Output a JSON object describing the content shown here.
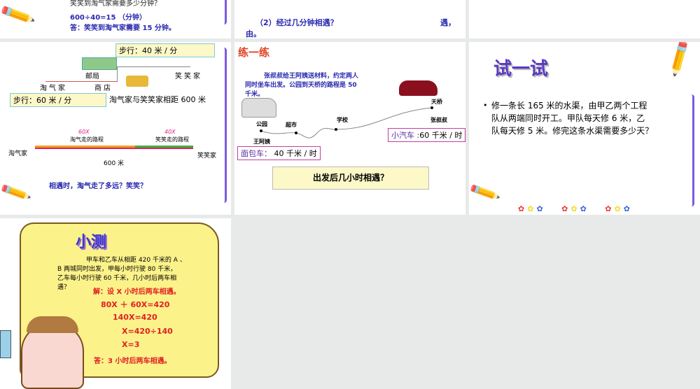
{
  "slides": [
    {
      "lines": [
        "笑笑到淘气家需要多少分钟？",
        "600÷40=15 （分钟）",
        "答：笑笑到淘气家需要 15 分钟。"
      ]
    },
    {
      "lines": [
        "（2）经过几分钟相遇？",
        "遇，",
        "由。"
      ]
    },
    {},
    {
      "speed_xiao": "步行：40 米 / 分",
      "speed_tao": "步行：60 米 / 分",
      "distance": "淘气家与笑笑家相距 600 米",
      "places": {
        "post": "邮局",
        "shop": "商店",
        "tao_home": "淘气家",
        "xiao_home": "笑笑家"
      },
      "seg_tao": "60X",
      "seg_tao_label": "淘气走的路程",
      "seg_xiao": "40X",
      "seg_xiao_label": "笑笑走的路程",
      "left": "淘气家",
      "right": "笑笑家",
      "total": "600 米",
      "question": "相遇时，淘气走了多远？笑笑？"
    },
    {
      "title": "练一练",
      "problem": [
        "张叔叔给王阿姨送材料，约定两人",
        "同时坐车出发。公园到天桥的路程是 50",
        "千米。"
      ],
      "places": {
        "park": "公园",
        "market": "超市",
        "school": "学校",
        "bridge": "天桥",
        "wang": "王阿姨",
        "zhang": "张叔叔"
      },
      "bus_label": "面包车：",
      "bus_speed": "40 千米 / 时",
      "car_label": "小汽车 :",
      "car_speed": "60 千米 / 时",
      "question": "出发后几小时相遇？"
    },
    {
      "title": "试一试",
      "bullet": "•",
      "lines": [
        "修一条长 165 米的水渠，由甲乙两个工程",
        "队从两端同时开工。甲队每天修 6 米，乙",
        "队每天修 5 米。修完这条水渠需要多少天？"
      ]
    },
    {
      "title": "小测",
      "problem": [
        "甲车和乙车从相距 420 千米的 A 、",
        "B 两城同时出发，甲每小时行驶 80 千米，",
        "乙车每小时行驶 60 千米，几小时后两车相",
        "遇？"
      ],
      "solution": [
        "解：设 X 小时后两车相遇。",
        "80X ＋ 60X=420",
        "140X=420",
        "X=420÷140",
        "X=3",
        "答：3 小时后两车相遇。"
      ]
    }
  ]
}
